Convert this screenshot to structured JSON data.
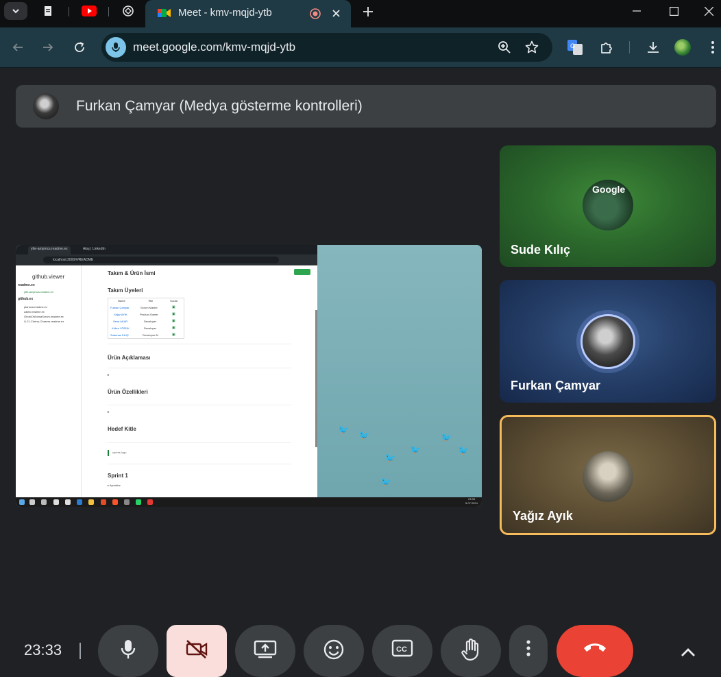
{
  "browser": {
    "active_tab_title": "Meet - kmv-mqjd-ytb",
    "url": "meet.google.com/kmv-mqjd-ytb"
  },
  "presenter_banner": "Furkan Çamyar (Medya gösterme kontrolleri)",
  "shared_screen": {
    "tabs": [
      "ytte-ampmcs.readme.ex",
      "Akış | LinkedIn"
    ],
    "url": "localhost:3000/#/README",
    "sidebar_title": "github.viewer",
    "sidebar_sections": [
      {
        "heading": "readme.ex",
        "items": [
          "ytte-ampmcs.readme.ex"
        ]
      },
      {
        "heading": "github.ex",
        "items": [
          "planova.readme.ex",
          "zatan.readme.ex",
          "GhostOfAnimaScrum.readme.ex",
          "U-21-Cherry-Chasers.readme.ex"
        ]
      }
    ],
    "heading_title": "Takım & Ürün İsmi",
    "heading_members": "Takım Üyeleri",
    "table_headers": [
      "Name",
      "Title",
      "Social"
    ],
    "table_rows": [
      [
        "Furkan Çamyar",
        "Scrum Master"
      ],
      [
        "Yağız AYIK",
        "Product Owner"
      ],
      [
        "Sena AKAR",
        "Developer"
      ],
      [
        "Kübra YÖRÜK",
        "Developer"
      ],
      [
        "Sudenaz KILIÇ",
        "Developer AI"
      ]
    ],
    "sections": [
      "Ürün Açıklaması",
      "Ürün Özellikleri",
      "Hedef Kitle"
    ],
    "sprints_note": "sprints logo",
    "sprint_heading": "Sprint 1",
    "sprint_details": "▸ Ayrıntılar",
    "taskbar_time": "23:33",
    "taskbar_date": "5.07.2024"
  },
  "participants": [
    {
      "name": "Sude Kılıç",
      "avatar_text": "Google"
    },
    {
      "name": "Furkan Çamyar"
    },
    {
      "name": "Yağız Ayık"
    }
  ],
  "clock": "23:33",
  "controls": {
    "mic": "microphone-icon",
    "camera": "camera-off-icon",
    "present": "present-screen-icon",
    "reactions": "emoji-icon",
    "captions": "captions-icon",
    "raise_hand": "hand-icon",
    "more": "more-vertical-icon",
    "leave": "end-call-icon",
    "expand": "chevron-up-icon"
  },
  "colors": {
    "end_call": "#ea4335",
    "camera_off_bg": "#f9dedc",
    "active_speaker_border": "#f6bb5a"
  }
}
